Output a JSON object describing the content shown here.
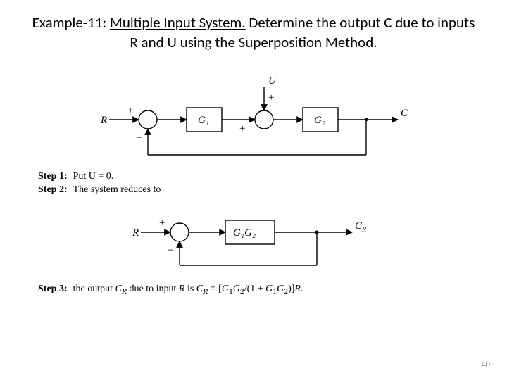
{
  "title": {
    "prefix": "Example-11: ",
    "underlined": "Multiple Input System.",
    "rest": " Determine the output C due to inputs R and U using the Superposition Method."
  },
  "diagram1": {
    "R": "R",
    "plus1": "+",
    "minus1": "−",
    "G1": "G₁",
    "U": "U",
    "plusU": "+",
    "plus2": "+",
    "G2": "G₂",
    "C": "C"
  },
  "steps12": {
    "s1label": "Step 1:",
    "s1text": "Put U = 0.",
    "s2label": "Step 2:",
    "s2text": "The system reduces to"
  },
  "diagram2": {
    "R": "R",
    "plus": "+",
    "minus": "−",
    "G1G2": "G₁G₂",
    "CR": "C_R"
  },
  "step3": {
    "label": "Step 3:",
    "text": "the output C_R due to input R is C_R = [G₁G₂/(1 + G₁G₂)]R."
  },
  "page": "40"
}
